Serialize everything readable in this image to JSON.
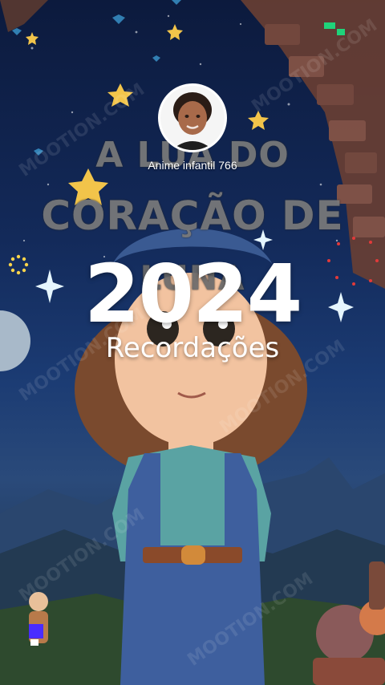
{
  "creator": {
    "name": "Anime infantil 766"
  },
  "poster": {
    "title_line1": "A LUA DO",
    "title_line2": "CORAÇÃO DE",
    "title_line3": "LUNA"
  },
  "overlay": {
    "year": "2024",
    "subtitle": "Recordações"
  },
  "watermark": {
    "text": "MOOTION.COM"
  },
  "colors": {
    "sky": "#132a5a",
    "accent_gold": "#f2c44a",
    "hair": "#7a4a2e",
    "overalls": "#3e5f9e",
    "shirt": "#5aa3a3"
  },
  "icons": [
    "sparkle-icon",
    "star-icon",
    "dots-icon"
  ]
}
